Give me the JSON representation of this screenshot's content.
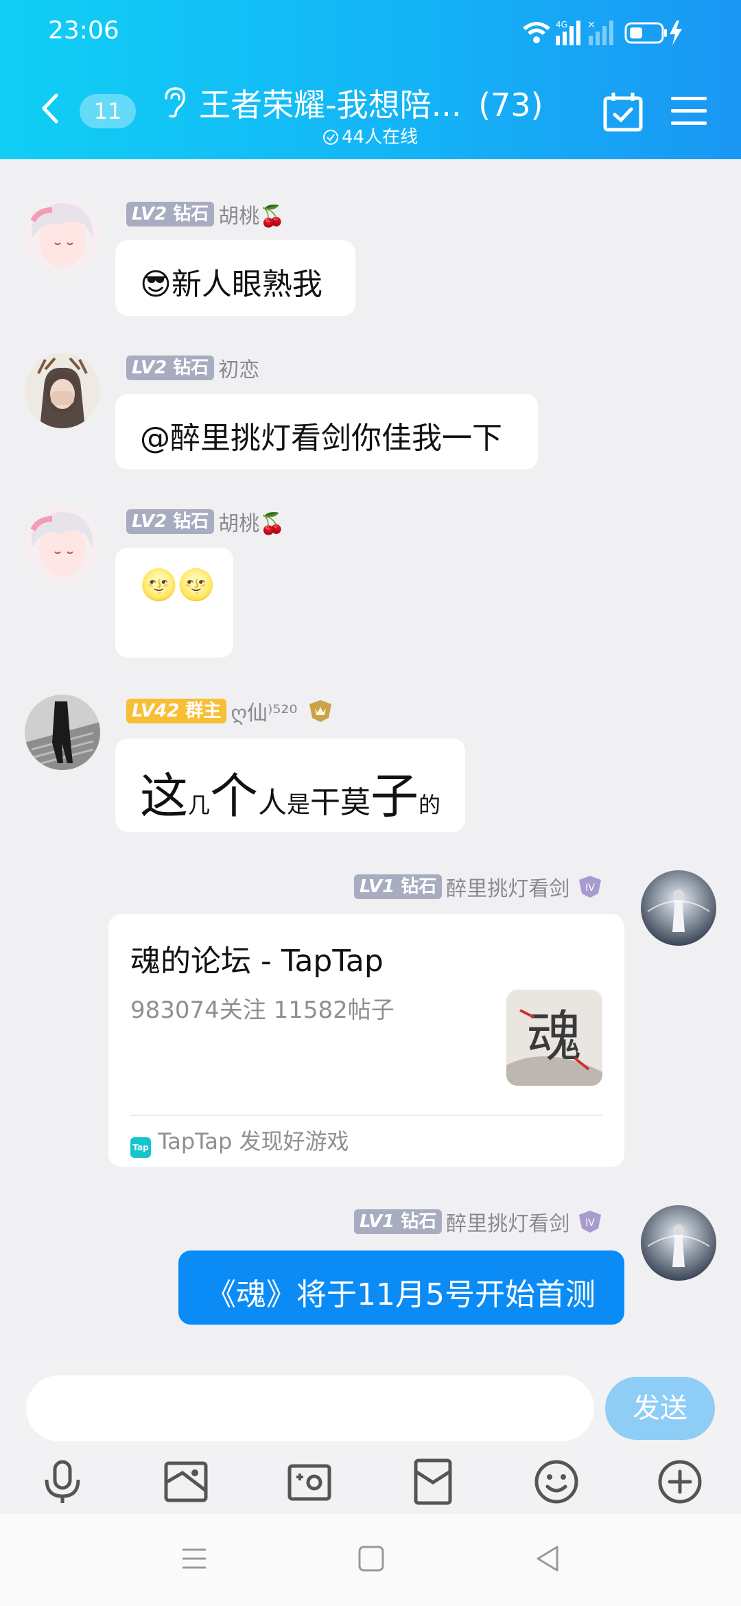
{
  "status": {
    "time": "23:06",
    "network": "4G"
  },
  "header": {
    "unread_count": "11",
    "title": "王者荣耀-我想陪...",
    "member_count": "(73)",
    "online": "44人在线"
  },
  "messages": [
    {
      "level": "LV2",
      "role": "钻石",
      "name": "胡桃🍒",
      "text": "😎新人眼熟我"
    },
    {
      "level": "LV2",
      "role": "钻石",
      "name": "初恋",
      "text": "@醉里挑灯看剑你佳我一下"
    },
    {
      "level": "LV2",
      "role": "钻石",
      "name": "胡桃🍒",
      "text": "🌝🌝"
    },
    {
      "level": "LV42",
      "role": "群主",
      "name": "ღ仙⁾⁵²⁰",
      "text_parts": [
        "这",
        "几",
        "个",
        "人",
        "是",
        "干",
        "莫",
        "子",
        "的"
      ]
    },
    {
      "level": "LV1",
      "role": "钻石",
      "name": "醉里挑灯看剑",
      "card": {
        "title": "魂的论坛 - TapTap",
        "subtitle": "983074关注 11582帖子",
        "footer": "TapTap 发现好游戏",
        "footer_icon": "Tap",
        "thumb_char": "魂"
      }
    },
    {
      "level": "LV1",
      "role": "钻石",
      "name": "醉里挑灯看剑",
      "text": "《魂》将于11月5号开始首测"
    }
  ],
  "input": {
    "placeholder": "",
    "send_label": "发送"
  },
  "toolbar": [
    "microphone-icon",
    "image-icon",
    "camera-icon",
    "red-packet-icon",
    "emoji-icon",
    "plus-icon"
  ],
  "colors": {
    "accent": "#0a8bf5",
    "header_start": "#10cff5",
    "header_end": "#1a97f4",
    "owner_badge": "#f8bf34",
    "level_badge": "#a8acc0"
  }
}
